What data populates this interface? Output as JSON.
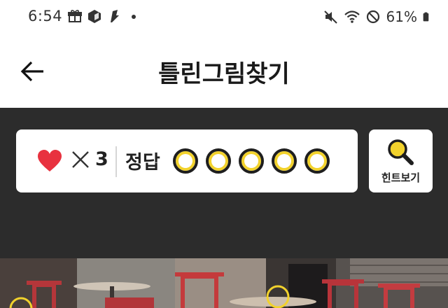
{
  "status_bar": {
    "time": "6:54",
    "battery_percent": "61%",
    "left_icons": [
      "gift-icon",
      "package-icon",
      "app-icon",
      "dot-icon"
    ],
    "right_icons": [
      "mute-icon",
      "wifi-icon",
      "no-disturb-icon",
      "battery-icon"
    ]
  },
  "header": {
    "title": "틀린그림찾기",
    "back_icon": "arrow-left-icon"
  },
  "game": {
    "lives_icon": "heart-icon",
    "lives_multiplier": "✕",
    "lives": "3",
    "answer_label": "정답",
    "answers_found": 0,
    "answers_total": 5,
    "hint_label": "힌트보기",
    "hint_icon": "magnifier-icon"
  },
  "colors": {
    "accent_yellow": "#f2d22c",
    "heart_red": "#e8323f",
    "game_background": "#2c2c2c"
  }
}
